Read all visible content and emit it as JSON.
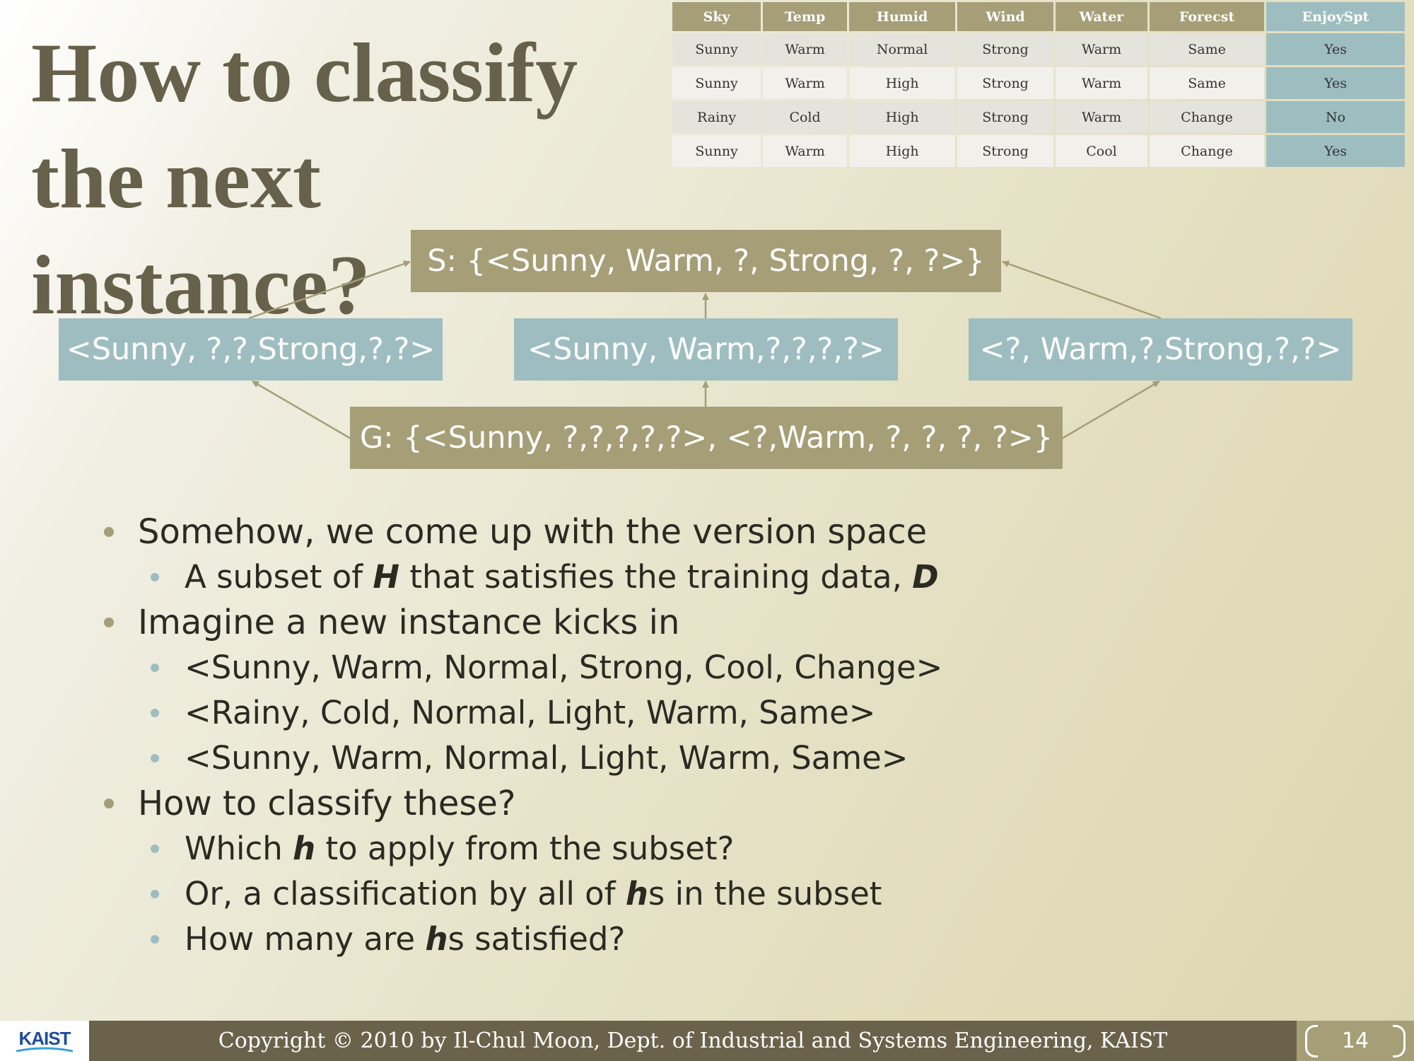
{
  "title": {
    "line1": "How to classify",
    "line2": "the next instance?"
  },
  "table": {
    "headers": [
      "Sky",
      "Temp",
      "Humid",
      "Wind",
      "Water",
      "Forecst",
      "EnjoySpt"
    ],
    "rows": [
      [
        "Sunny",
        "Warm",
        "Normal",
        "Strong",
        "Warm",
        "Same",
        "Yes"
      ],
      [
        "Sunny",
        "Warm",
        "High",
        "Strong",
        "Warm",
        "Same",
        "Yes"
      ],
      [
        "Rainy",
        "Cold",
        "High",
        "Strong",
        "Warm",
        "Change",
        "No"
      ],
      [
        "Sunny",
        "Warm",
        "High",
        "Strong",
        "Cool",
        "Change",
        "Yes"
      ]
    ]
  },
  "diagram": {
    "s_boundary": "S: {<Sunny, Warm, ?, Strong, ?, ?>}",
    "middle_left": "<Sunny, ?,?,Strong,?,?>",
    "middle_center": "<Sunny, Warm,?,?,?,?>",
    "middle_right": "<?, Warm,?,Strong,?,?>",
    "g_boundary": "G: {<Sunny, ?,?,?,?,?>, <?,Warm, ?, ?, ?, ?>}"
  },
  "bullets": {
    "b1": "Somehow, we come up with the version space",
    "b1_1_pre": "A subset of ",
    "b1_1_em1": "H",
    "b1_1_mid": " that satisfies the training data, ",
    "b1_1_em2": "D",
    "b2": "Imagine a new instance kicks in",
    "b2_1": "<Sunny, Warm, Normal, Strong, Cool, Change>",
    "b2_2": "<Rainy, Cold, Normal, Light, Warm, Same>",
    "b2_3": "<Sunny, Warm, Normal, Light, Warm, Same>",
    "b3": "How to classify these?",
    "b3_1_pre": "Which ",
    "b3_1_em": "h",
    "b3_1_post": " to apply from the subset?",
    "b3_2_pre": "Or, a classification by all of ",
    "b3_2_em": "h",
    "b3_2_post": "s in the subset",
    "b3_3_pre": "How many are ",
    "b3_3_em": "h",
    "b3_3_post": "s satisfied?"
  },
  "footer": {
    "logo": "KAIST",
    "copyright": "Copyright © 2010 by Il-Chul Moon, Dept. of Industrial and Systems Engineering, KAIST",
    "page_number": "14"
  },
  "colors": {
    "title": "#67604a",
    "olive": "#a59e77",
    "teal": "#9ebdc0",
    "footer": "#6b624b"
  }
}
